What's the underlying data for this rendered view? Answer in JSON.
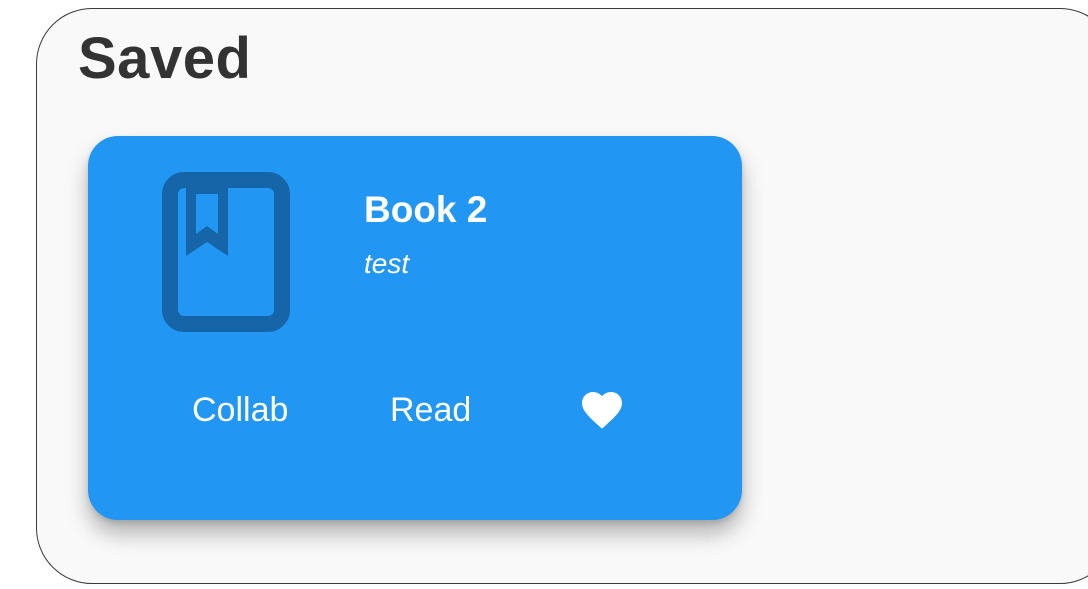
{
  "page": {
    "title": "Saved"
  },
  "card": {
    "title": "Book 2",
    "subtitle": "test",
    "icon": "book-bookmark-icon",
    "background_color": "#2196f3",
    "icon_color": "#1565a8",
    "actions": {
      "collab_label": "Collab",
      "read_label": "Read",
      "favorite_icon": "heart-icon",
      "favorited": true
    }
  }
}
